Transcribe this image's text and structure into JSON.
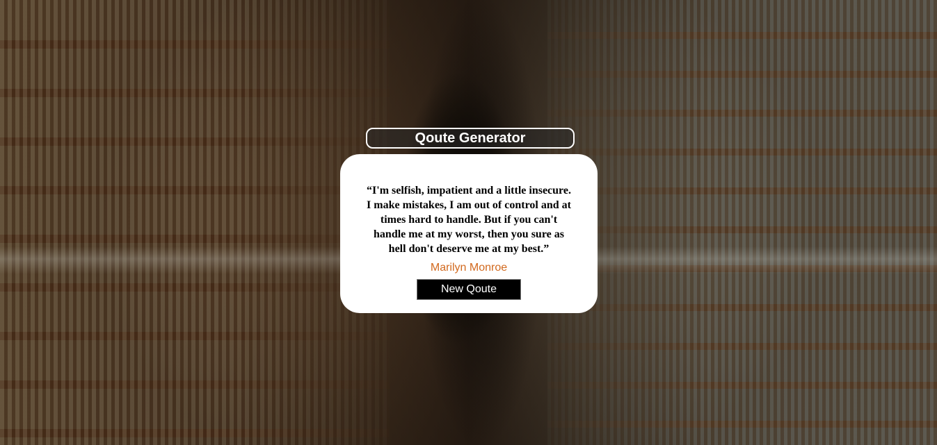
{
  "header": {
    "title": "Qoute Generator"
  },
  "quote_card": {
    "quote_text": "“I'm selfish, impatient and a little insecure. I make mistakes, I am out of control and at times hard to handle. But if you can't handle me at my worst, then you sure as hell don't deserve me at my best.”",
    "author": "Marilyn Monroe",
    "new_quote_label": "New Qoute"
  },
  "colors": {
    "author": "#d2691e",
    "button_bg": "#000000",
    "card_bg": "#ffffff"
  }
}
